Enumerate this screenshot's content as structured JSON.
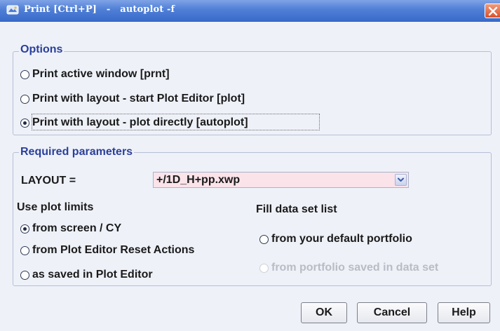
{
  "titlebar": {
    "title": "Print [Ctrl+P]   -   autoplot -f",
    "app_icon": "app-icon",
    "close_icon": "close-icon"
  },
  "options": {
    "title": "Options",
    "items": [
      {
        "label": "Print active window [prnt]",
        "checked": false
      },
      {
        "label": "Print with layout - start Plot Editor [plot]",
        "checked": false
      },
      {
        "label": "Print with layout - plot directly [autoplot]",
        "checked": true
      }
    ]
  },
  "params": {
    "title": "Required parameters",
    "layout_label": "LAYOUT =",
    "layout_value": "+/1D_H+pp.xwp",
    "plot_limits": {
      "title": "Use plot limits",
      "items": [
        {
          "label": "from screen / CY",
          "checked": true
        },
        {
          "label": "from Plot Editor Reset Actions",
          "checked": false
        },
        {
          "label": "as saved in Plot Editor",
          "checked": false
        }
      ]
    },
    "data_set": {
      "title": "Fill data set list",
      "items": [
        {
          "label": "from your default portfolio",
          "checked": false,
          "enabled": true
        },
        {
          "label": "from portfolio saved in data set",
          "checked": false,
          "enabled": false
        }
      ]
    }
  },
  "buttons": {
    "ok": "OK",
    "cancel": "Cancel",
    "help": "Help"
  },
  "colors": {
    "title_bar": "#3a6bcb",
    "group_title": "#2b3f9a",
    "combo_background": "#fbe3ea",
    "dialog_background": "#eef1f8"
  }
}
